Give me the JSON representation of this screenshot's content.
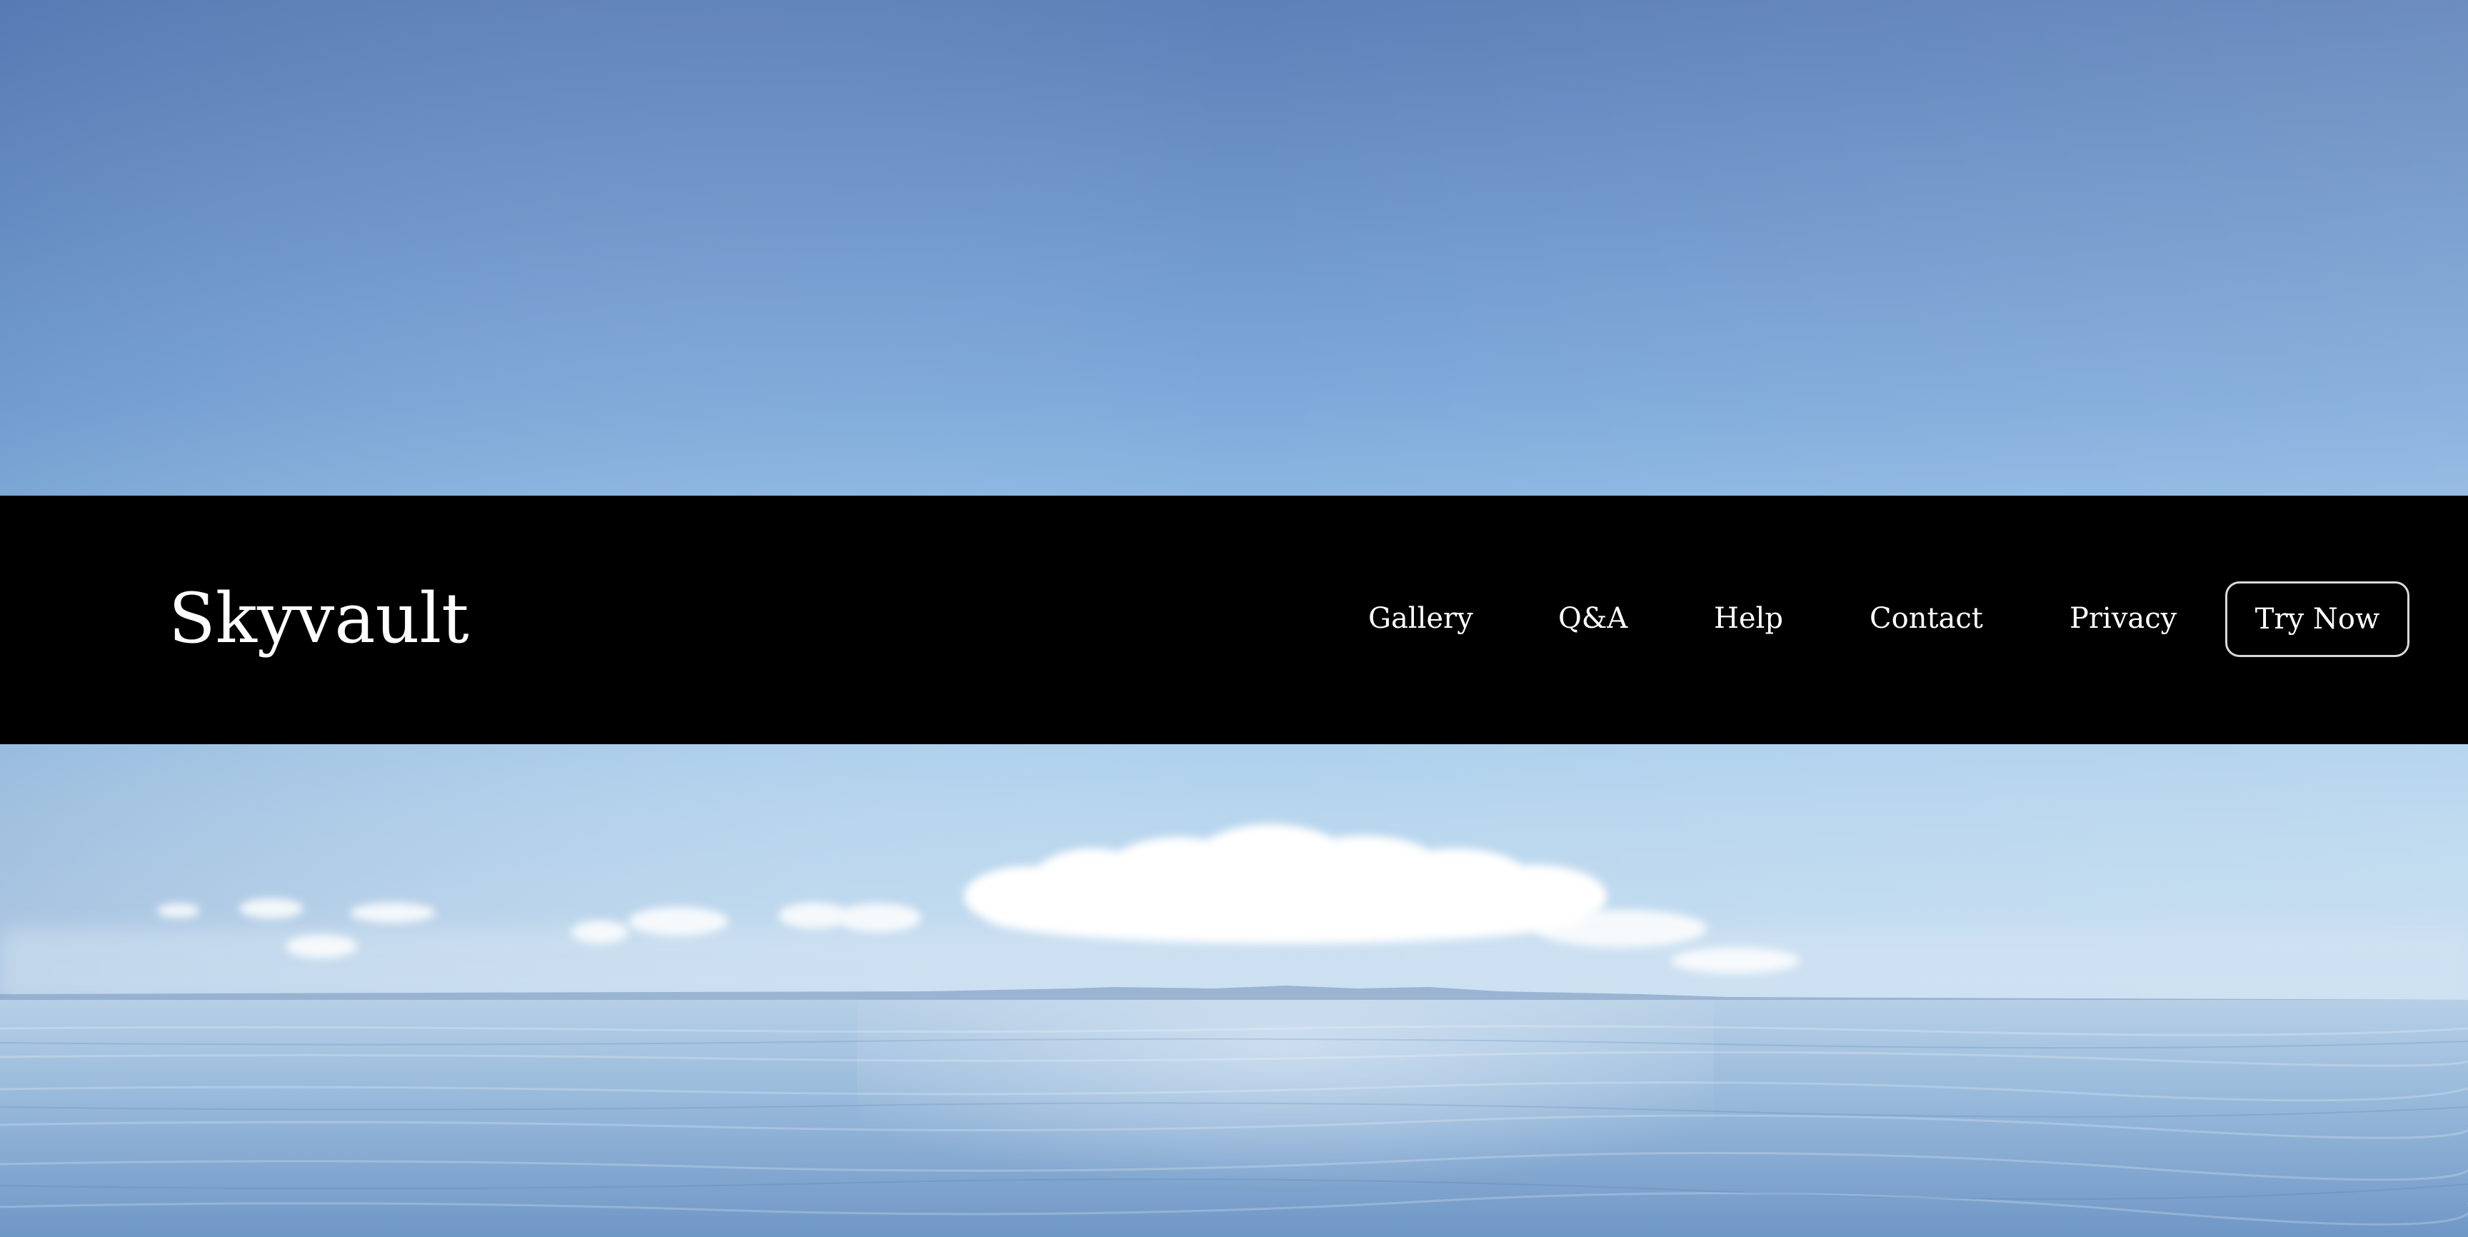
{
  "brand": {
    "name": "Skyvault"
  },
  "nav": {
    "items": [
      {
        "label": "Gallery"
      },
      {
        "label": "Q&A"
      },
      {
        "label": "Help"
      },
      {
        "label": "Contact"
      },
      {
        "label": "Privacy"
      }
    ],
    "cta_label": "Try Now"
  },
  "colors": {
    "nav_background": "#000000",
    "nav_text": "#ffffff",
    "cta_border": "#d9d9d9",
    "sky_top": "#5f86bd",
    "sky_horizon": "#c3dcf0",
    "sea": "#88add3"
  },
  "hero": {
    "image_subject": "sky-and-sea-photo"
  }
}
